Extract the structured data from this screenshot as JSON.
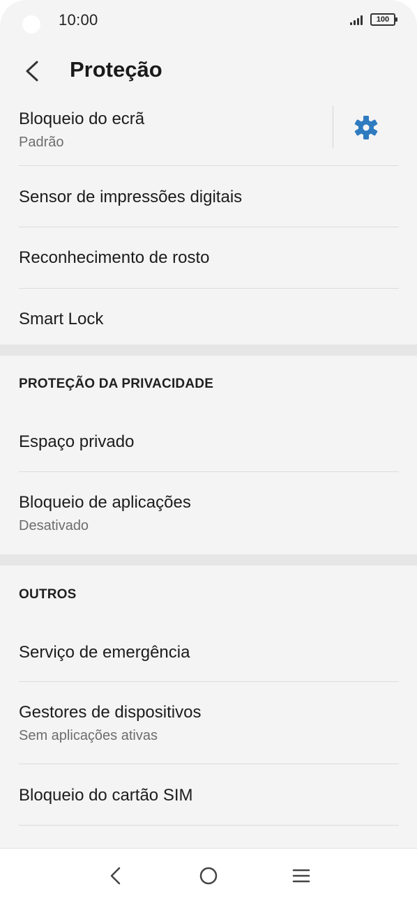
{
  "status_bar": {
    "time": "10:00",
    "battery": "100",
    "icons": [
      "camera-dot",
      "signal-icon",
      "battery-icon"
    ]
  },
  "header": {
    "title": "Proteção",
    "back_icon": "chevron-left-icon"
  },
  "security": {
    "items": [
      {
        "title": "Bloqueio do ecrã",
        "subtitle": "Padrão",
        "action_icon": "gear-icon"
      },
      {
        "title": "Sensor de impressões digitais"
      },
      {
        "title": "Reconhecimento de rosto"
      },
      {
        "title": "Smart Lock"
      }
    ]
  },
  "privacy": {
    "header": "PROTEÇÃO DA PRIVACIDADE",
    "items": [
      {
        "title": "Espaço privado"
      },
      {
        "title": "Bloqueio de aplicações",
        "subtitle": "Desativado"
      }
    ]
  },
  "others": {
    "header": "OUTROS",
    "items": [
      {
        "title": "Serviço de emergência"
      },
      {
        "title": "Gestores de dispositivos",
        "subtitle": "Sem aplicações ativas"
      },
      {
        "title": "Bloqueio do cartão SIM"
      }
    ]
  },
  "nav_bar": {
    "icons": [
      "back-icon",
      "home-icon",
      "recents-icon"
    ]
  },
  "colors": {
    "accent": "#2f7bc0",
    "background": "#f4f4f4",
    "section_gap": "#e6e6e6"
  }
}
